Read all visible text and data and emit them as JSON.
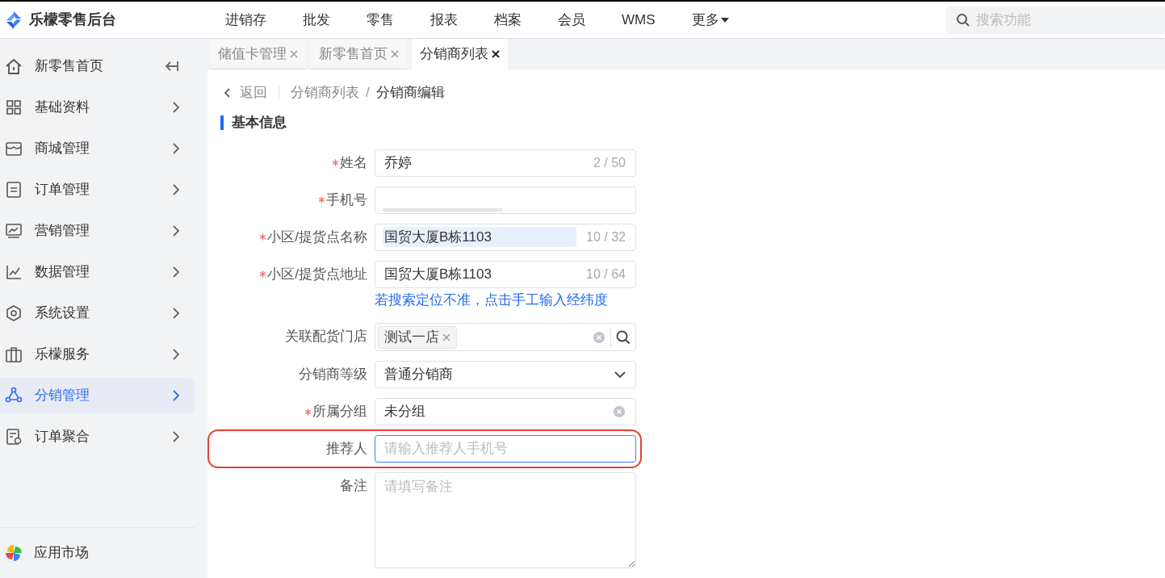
{
  "app": {
    "title": "乐檬零售后台"
  },
  "top_nav": [
    {
      "label": "进销存",
      "has_caret": false
    },
    {
      "label": "批发",
      "has_caret": false
    },
    {
      "label": "零售",
      "has_caret": false
    },
    {
      "label": "报表",
      "has_caret": false
    },
    {
      "label": "档案",
      "has_caret": false
    },
    {
      "label": "会员",
      "has_caret": false
    },
    {
      "label": "WMS",
      "has_caret": false
    },
    {
      "label": "更多",
      "has_caret": true
    }
  ],
  "search": {
    "placeholder": "搜索功能"
  },
  "sidebar": {
    "items": [
      {
        "label": "新零售首页",
        "kind": "home",
        "selected": false
      },
      {
        "label": "基础资料",
        "kind": "menu",
        "selected": false
      },
      {
        "label": "商城管理",
        "kind": "menu",
        "selected": false
      },
      {
        "label": "订单管理",
        "kind": "menu",
        "selected": false
      },
      {
        "label": "营销管理",
        "kind": "menu",
        "selected": false
      },
      {
        "label": "数据管理",
        "kind": "menu",
        "selected": false
      },
      {
        "label": "系统设置",
        "kind": "menu",
        "selected": false
      },
      {
        "label": "乐檬服务",
        "kind": "menu",
        "selected": false
      },
      {
        "label": "分销管理",
        "kind": "menu",
        "selected": true
      },
      {
        "label": "订单聚合",
        "kind": "menu",
        "selected": false
      }
    ],
    "footer": {
      "label": "应用市场"
    }
  },
  "tabs": [
    {
      "label": "储值卡管理",
      "selected": false
    },
    {
      "label": "新零售首页",
      "selected": false
    },
    {
      "label": "分销商列表",
      "selected": true
    }
  ],
  "breadcrumb": {
    "back": "返回",
    "separator": "/",
    "items": [
      "分销商列表",
      "分销商编辑"
    ]
  },
  "section": {
    "title": "基本信息"
  },
  "form": [
    {
      "kind": "text",
      "label": "姓名",
      "required": true,
      "value": "乔婷",
      "counter": "2 / 50"
    },
    {
      "kind": "redacted",
      "label": "手机号",
      "required": true
    },
    {
      "kind": "text",
      "label": "小区/提货点名称",
      "required": true,
      "value": "国贸大厦B栋1103",
      "counter": "10 / 32",
      "text_selected": true
    },
    {
      "kind": "text",
      "label": "小区/提货点地址",
      "required": true,
      "value": "国贸大厦B栋1103",
      "counter": "10 / 64",
      "hint_link": "若搜索定位不准，点击手工输入经纬度"
    },
    {
      "kind": "tags",
      "label": "关联配货门店",
      "required": false,
      "tags": [
        "测试一店"
      ]
    },
    {
      "kind": "select",
      "label": "分销商等级",
      "required": false,
      "value": "普通分销商"
    },
    {
      "kind": "clearable",
      "label": "所属分组",
      "required": true,
      "value": "未分组"
    },
    {
      "kind": "input",
      "label": "推荐人",
      "required": false,
      "placeholder": "请输入推荐人手机号",
      "focused": true,
      "highlighted": true
    },
    {
      "kind": "textarea",
      "label": "备注",
      "required": false,
      "placeholder": "请填写备注"
    }
  ]
}
